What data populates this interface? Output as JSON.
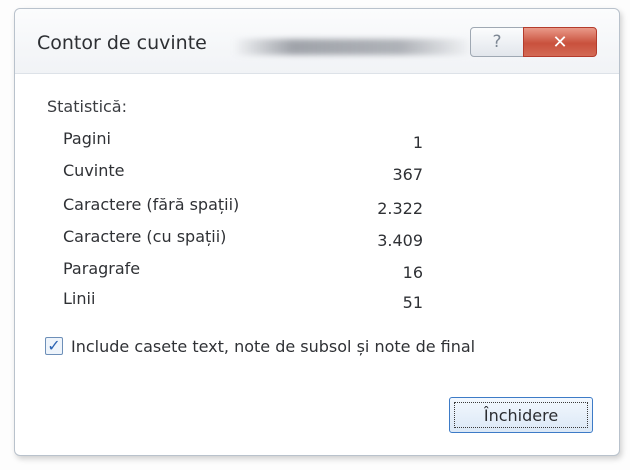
{
  "dialog": {
    "title": "Contor de cuvinte",
    "help_glyph": "?",
    "close_glyph": "✕"
  },
  "statistics": {
    "label": "Statistică:",
    "rows": [
      {
        "name": "Pagini",
        "value": "1"
      },
      {
        "name": "Cuvinte",
        "value": "367"
      },
      {
        "name": "Caractere (fără spații)",
        "value": "2.322"
      },
      {
        "name": "Caractere (cu spații)",
        "value": "3.409"
      },
      {
        "name": "Paragrafe",
        "value": "16"
      },
      {
        "name": "Linii",
        "value": "51"
      }
    ]
  },
  "include_checkbox": {
    "checked": true,
    "check_glyph": "✓",
    "label": "Include casete text, note de subsol și note de final"
  },
  "buttons": {
    "close_label": "Închidere"
  },
  "colors": {
    "close_button_red": "#c9513d",
    "focus_blue": "#3d7bc7"
  }
}
